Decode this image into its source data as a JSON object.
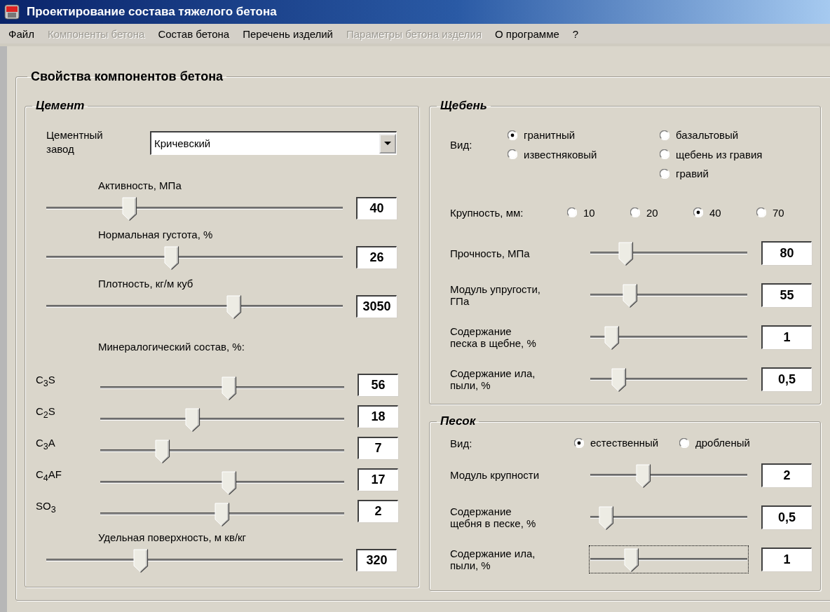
{
  "window": {
    "title": "Проектирование состава тяжелого бетона"
  },
  "menu": [
    {
      "label": "Файл",
      "disabled": false
    },
    {
      "label": "Компоненты бетона",
      "disabled": true
    },
    {
      "label": "Состав бетона",
      "disabled": false
    },
    {
      "label": "Перечень изделий",
      "disabled": false
    },
    {
      "label": "Параметры бетона изделия",
      "disabled": true
    },
    {
      "label": "О программе",
      "disabled": false
    },
    {
      "label": "?",
      "disabled": false
    }
  ],
  "properties_group": {
    "title": "Свойства компонентов бетона"
  },
  "cement": {
    "title": "Цемент",
    "plant": {
      "label": "Цементный\nзавод",
      "value": "Кричевский"
    },
    "properties": [
      {
        "label": "Активность, МПа",
        "level": 0.27,
        "value": "40"
      },
      {
        "label": "Нормальная густота, %",
        "level": 0.42,
        "value": "26"
      },
      {
        "label": "Плотность, кг/м куб",
        "level": 0.64,
        "value": "3050"
      }
    ],
    "mineral_title": "Минералогический состав, %:",
    "minerals": [
      {
        "label": "C$_{3}$S",
        "level": 0.53,
        "value": "56"
      },
      {
        "label": "C$_{2}$S",
        "level": 0.37,
        "value": "18"
      },
      {
        "label": "C$_{3}$A",
        "level": 0.24,
        "value": "7"
      },
      {
        "label": "C$_{4}$AF",
        "level": 0.53,
        "value": "17"
      },
      {
        "label": "SO$_{3}$",
        "level": 0.5,
        "value": "2"
      }
    ],
    "surface": {
      "label": "Удельная поверхность, м кв/кг",
      "level": 0.31,
      "value": "320"
    }
  },
  "crushed_stone": {
    "title": "Щебень",
    "type": {
      "label": "Вид:",
      "columns": [
        [
          {
            "label": "гранитный",
            "selected": true
          },
          {
            "label": "известняковый",
            "selected": false
          }
        ],
        [
          {
            "label": "базальтовый",
            "selected": false
          },
          {
            "label": "щебень из гравия",
            "selected": false
          },
          {
            "label": "гравий",
            "selected": false
          }
        ]
      ]
    },
    "size": {
      "label": "Крупность, мм:",
      "options": [
        {
          "label": "10",
          "selected": false
        },
        {
          "label": "20",
          "selected": false
        },
        {
          "label": "40",
          "selected": true
        },
        {
          "label": "70",
          "selected": false
        }
      ]
    },
    "sliders": [
      {
        "label": "Прочность, МПа",
        "level": 0.2,
        "value": "80",
        "focused": false
      },
      {
        "label": "Модуль упругости,\nГПа",
        "level": 0.23,
        "value": "55",
        "focused": false
      },
      {
        "label": "Содержание\nпеска в щебне, %",
        "level": 0.1,
        "value": "1",
        "focused": false
      },
      {
        "label": "Содержание ила,\nпыли, %",
        "level": 0.15,
        "value": "0,5",
        "focused": false
      }
    ]
  },
  "sand": {
    "title": "Песок",
    "type": {
      "label": "Вид:",
      "options": [
        {
          "label": "естественный",
          "selected": true
        },
        {
          "label": "дробленый",
          "selected": false
        }
      ]
    },
    "sliders": [
      {
        "label": "Модуль крупности",
        "level": 0.32,
        "value": "2",
        "focused": false
      },
      {
        "label": "Содержание\nщебня в песке, %",
        "level": 0.06,
        "value": "0,5",
        "focused": false
      },
      {
        "label": "Содержание ила,\nпыли, %",
        "level": 0.24,
        "value": "1",
        "focused": true
      }
    ]
  }
}
